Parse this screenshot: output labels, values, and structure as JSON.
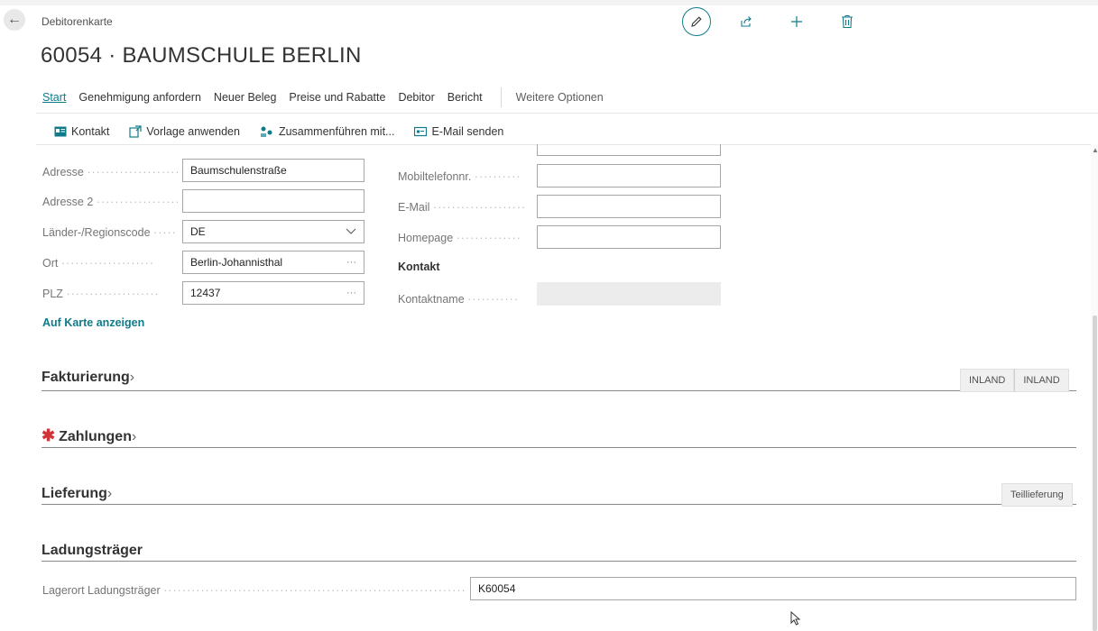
{
  "header": {
    "caption": "Debitorenkarte",
    "title": "60054 · BAUMSCHULE BERLIN",
    "actions": [
      {
        "icon": "pencil-icon"
      },
      {
        "icon": "share-icon"
      },
      {
        "icon": "plus-icon"
      },
      {
        "icon": "trash-icon"
      }
    ]
  },
  "menu": {
    "items": [
      "Start",
      "Genehmigung anfordern",
      "Neuer Beleg",
      "Preise und Rabatte",
      "Debitor",
      "Bericht"
    ],
    "more": "Weitere Optionen"
  },
  "toolbar": {
    "items": [
      {
        "label": "Kontakt",
        "icon": "contact-card-icon"
      },
      {
        "label": "Vorlage anwenden",
        "icon": "apply-template-icon"
      },
      {
        "label": "Zusammenführen mit...",
        "icon": "merge-icon"
      },
      {
        "label": "E-Mail senden",
        "icon": "email-icon"
      }
    ]
  },
  "address": {
    "adresse_label": "Adresse",
    "adresse_value": "Baumschulenstraße",
    "adresse2_label": "Adresse 2",
    "adresse2_value": "",
    "country_label": "Länder-/Regionscode",
    "country_value": "DE",
    "ort_label": "Ort",
    "ort_value": "Berlin-Johannisthal",
    "plz_label": "PLZ",
    "plz_value": "12437",
    "map_link": "Auf Karte anzeigen"
  },
  "contact": {
    "mobile_label": "Mobiltelefonnr.",
    "mobile_value": "",
    "email_label": "E-Mail",
    "email_value": "",
    "homepage_label": "Homepage",
    "homepage_value": "",
    "heading": "Kontakt",
    "contactname_label": "Kontaktname",
    "contactname_value": ""
  },
  "sections": {
    "fakturierung": {
      "title": "Fakturierung",
      "badges": [
        "INLAND",
        "INLAND"
      ]
    },
    "zahlungen": {
      "title": "Zahlungen",
      "required_mark": "✱"
    },
    "lieferung": {
      "title": "Lieferung",
      "badges": [
        "Teillieferung"
      ]
    },
    "ladungstraeger": {
      "title": "Ladungsträger",
      "lagerort_label": "Lagerort Ladungsträger",
      "lagerort_value": "K60054"
    }
  },
  "colors": {
    "accent": "#0f7b8a",
    "required": "#d13438"
  }
}
